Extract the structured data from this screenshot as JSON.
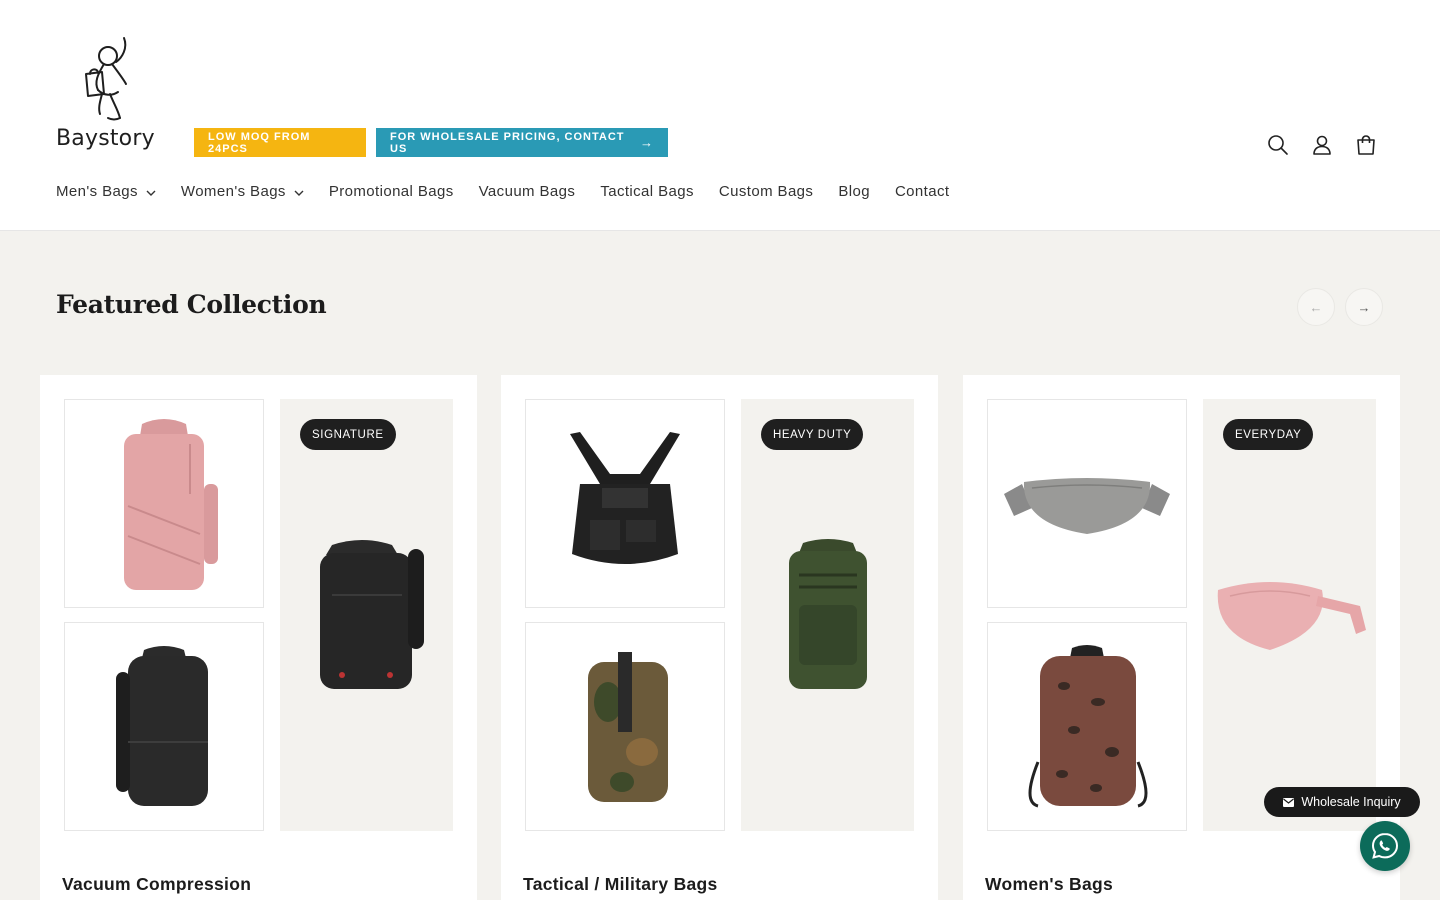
{
  "brand": {
    "name": "Baystory"
  },
  "promos": {
    "moq_label": "LOW MOQ FROM 24PCS",
    "wholesale_label": "FOR WHOLESALE PRICING, CONTACT US",
    "moq_color": "#f5b511",
    "wholesale_color": "#2a9ab5"
  },
  "header_icons": [
    "search-icon",
    "account-icon",
    "cart-icon"
  ],
  "nav": {
    "items": [
      {
        "label": "Men's Bags",
        "has_dropdown": true
      },
      {
        "label": "Women's Bags",
        "has_dropdown": true
      },
      {
        "label": "Promotional Bags",
        "has_dropdown": false
      },
      {
        "label": "Vacuum Bags",
        "has_dropdown": false
      },
      {
        "label": "Tactical Bags",
        "has_dropdown": false
      },
      {
        "label": "Custom Bags",
        "has_dropdown": false
      },
      {
        "label": "Blog",
        "has_dropdown": false
      },
      {
        "label": "Contact",
        "has_dropdown": false
      }
    ]
  },
  "featured": {
    "title": "Featured Collection",
    "prev_icon": "arrow-left-icon",
    "next_icon": "arrow-right-icon",
    "cards": [
      {
        "title": "Vacuum Compression",
        "badge": "SIGNATURE",
        "images": [
          "pink-travel-backpack",
          "black-laptop-backpack",
          "black-travel-backpack"
        ]
      },
      {
        "title": "Tactical / Military Bags",
        "badge": "HEAVY DUTY",
        "images": [
          "black-chest-rig",
          "camo-sling-bag",
          "olive-tactical-backpack"
        ]
      },
      {
        "title": "Women's Bags",
        "badge": "EVERYDAY",
        "images": [
          "grey-crossbody-bag",
          "leopard-backpack",
          "pink-belt-bag"
        ]
      }
    ]
  },
  "floating": {
    "wholesale_label": "Wholesale Inquiry",
    "whatsapp_color": "#0c6b5a"
  },
  "colors": {
    "section_bg": "#f3f2ee",
    "badge_bg": "#1f1f1f"
  }
}
